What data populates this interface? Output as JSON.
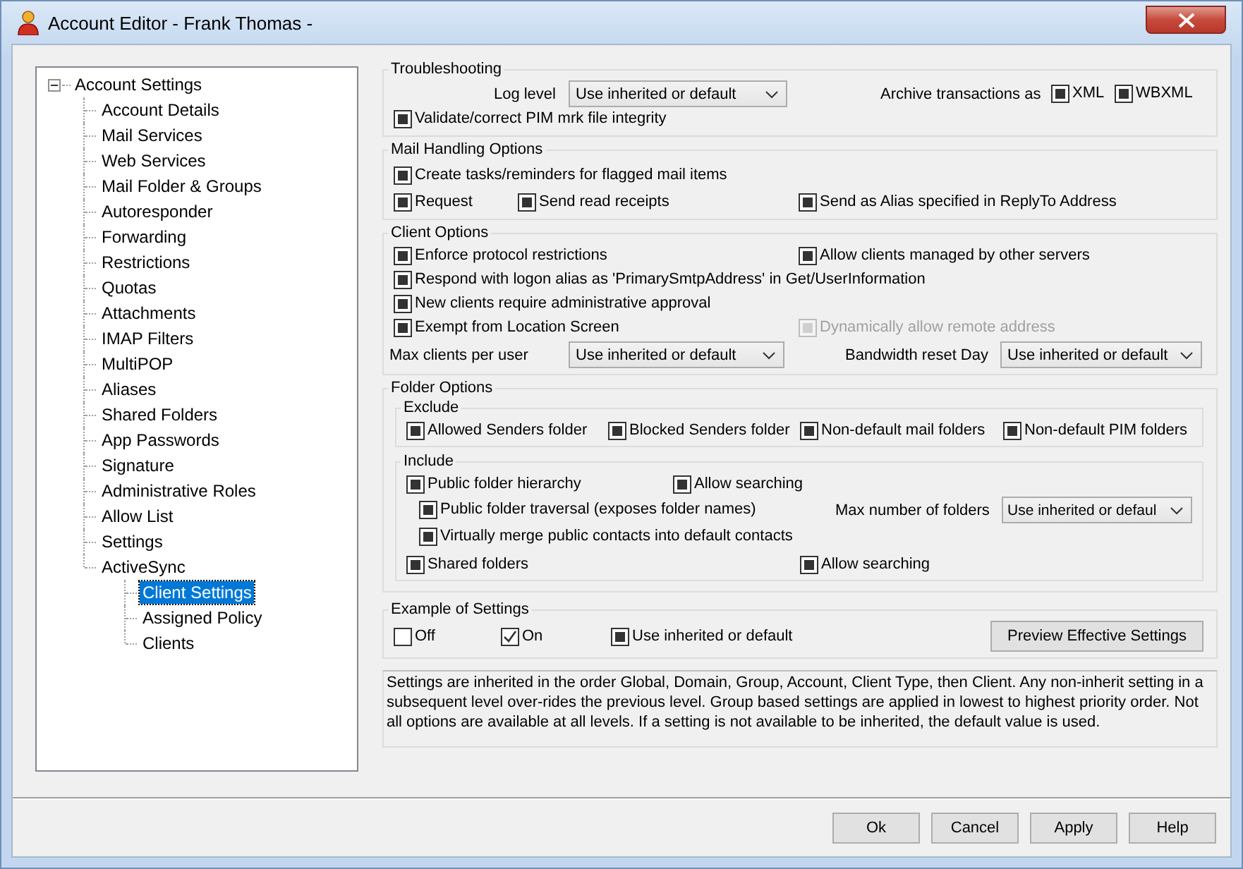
{
  "window": {
    "title": "Account Editor - Frank Thomas -"
  },
  "tree": {
    "label": "Account Settings",
    "expanded": true,
    "selected": false,
    "children": [
      {
        "label": "Account Details",
        "selected": false
      },
      {
        "label": "Mail Services",
        "selected": false
      },
      {
        "label": "Web Services",
        "selected": false
      },
      {
        "label": "Mail Folder & Groups",
        "selected": false
      },
      {
        "label": "Autoresponder",
        "selected": false
      },
      {
        "label": "Forwarding",
        "selected": false
      },
      {
        "label": "Restrictions",
        "selected": false
      },
      {
        "label": "Quotas",
        "selected": false
      },
      {
        "label": "Attachments",
        "selected": false
      },
      {
        "label": "IMAP Filters",
        "selected": false
      },
      {
        "label": "MultiPOP",
        "selected": false
      },
      {
        "label": "Aliases",
        "selected": false
      },
      {
        "label": "Shared Folders",
        "selected": false
      },
      {
        "label": "App Passwords",
        "selected": false
      },
      {
        "label": "Signature",
        "selected": false
      },
      {
        "label": "Administrative Roles",
        "selected": false
      },
      {
        "label": "Allow List",
        "selected": false
      },
      {
        "label": "Settings",
        "selected": false
      },
      {
        "label": "ActiveSync",
        "selected": false,
        "children": [
          {
            "label": "Client Settings",
            "selected": true
          },
          {
            "label": "Assigned Policy",
            "selected": false
          },
          {
            "label": "Clients",
            "selected": false
          }
        ]
      }
    ]
  },
  "sections": [
    {
      "title": "Troubleshooting",
      "rows": [
        {
          "items": [
            {
              "kind": "dropdown",
              "label": "Log level",
              "value": "Use inherited or default"
            },
            {
              "kind": "text",
              "text": "Archive transactions as"
            },
            {
              "kind": "checkbox",
              "label": "XML",
              "checked": false,
              "indeterminate": true,
              "disabled": false
            },
            {
              "kind": "checkbox",
              "label": "WBXML",
              "checked": false,
              "indeterminate": true,
              "disabled": false
            }
          ]
        },
        {
          "items": [
            {
              "kind": "checkbox",
              "label": "Validate/correct PIM mrk file integrity",
              "checked": false,
              "indeterminate": true,
              "disabled": false
            }
          ]
        }
      ]
    },
    {
      "title": "Mail Handling Options",
      "rows": [
        {
          "items": [
            {
              "kind": "checkbox",
              "label": "Create tasks/reminders for flagged mail items",
              "checked": false,
              "indeterminate": true,
              "disabled": false
            }
          ]
        },
        {
          "items": [
            {
              "kind": "checkbox",
              "label": "Request",
              "checked": false,
              "indeterminate": true,
              "disabled": false
            },
            {
              "kind": "checkbox",
              "label": "Send read receipts",
              "checked": false,
              "indeterminate": true,
              "disabled": false
            },
            {
              "kind": "checkbox",
              "label": "Send as Alias specified in ReplyTo Address",
              "checked": false,
              "indeterminate": true,
              "disabled": false
            }
          ]
        }
      ]
    },
    {
      "title": "Client Options",
      "rows": [
        {
          "items": [
            {
              "kind": "checkbox",
              "label": "Enforce protocol restrictions",
              "checked": false,
              "indeterminate": true,
              "disabled": false
            },
            {
              "kind": "checkbox",
              "label": "Allow clients managed by other servers",
              "checked": false,
              "indeterminate": true,
              "disabled": false
            }
          ]
        },
        {
          "items": [
            {
              "kind": "checkbox",
              "label": "Respond with logon alias as 'PrimarySmtpAddress' in Get/UserInformation",
              "checked": false,
              "indeterminate": true,
              "disabled": false
            }
          ]
        },
        {
          "items": [
            {
              "kind": "checkbox",
              "label": "New clients require administrative approval",
              "checked": false,
              "indeterminate": true,
              "disabled": false
            }
          ]
        },
        {
          "items": [
            {
              "kind": "checkbox",
              "label": "Exempt from Location Screen",
              "checked": false,
              "indeterminate": true,
              "disabled": false
            },
            {
              "kind": "checkbox",
              "label": "Dynamically allow remote address",
              "checked": false,
              "indeterminate": true,
              "disabled": true
            }
          ]
        },
        {
          "items": [
            {
              "kind": "dropdown",
              "label": "Max clients per user",
              "value": "Use inherited or default"
            },
            {
              "kind": "dropdown",
              "label": "Bandwidth reset Day",
              "value": "Use inherited or default"
            }
          ]
        }
      ]
    },
    {
      "title": "Folder Options",
      "groups": [
        {
          "title": "Exclude",
          "rows": [
            {
              "items": [
                {
                  "kind": "checkbox",
                  "label": "Allowed Senders folder",
                  "checked": false,
                  "indeterminate": true,
                  "disabled": false
                },
                {
                  "kind": "checkbox",
                  "label": "Blocked Senders folder",
                  "checked": false,
                  "indeterminate": true,
                  "disabled": false
                },
                {
                  "kind": "checkbox",
                  "label": "Non-default mail folders",
                  "checked": false,
                  "indeterminate": true,
                  "disabled": false
                },
                {
                  "kind": "checkbox",
                  "label": "Non-default PIM folders",
                  "checked": false,
                  "indeterminate": true,
                  "disabled": false
                }
              ]
            }
          ]
        },
        {
          "title": "Include",
          "rows": [
            {
              "items": [
                {
                  "kind": "checkbox",
                  "label": "Public folder hierarchy",
                  "checked": false,
                  "indeterminate": true,
                  "disabled": false
                },
                {
                  "kind": "checkbox",
                  "label": "Allow searching",
                  "checked": false,
                  "indeterminate": true,
                  "disabled": false
                }
              ]
            },
            {
              "items": [
                {
                  "kind": "checkbox",
                  "label": "Public folder traversal (exposes folder names)",
                  "checked": false,
                  "indeterminate": true,
                  "disabled": false
                },
                {
                  "kind": "dropdown",
                  "label": "Max number of folders",
                  "value": "Use inherited or defaul"
                }
              ]
            },
            {
              "items": [
                {
                  "kind": "checkbox",
                  "label": "Virtually merge public contacts into default contacts",
                  "checked": false,
                  "indeterminate": true,
                  "disabled": false
                }
              ]
            },
            {
              "items": [
                {
                  "kind": "checkbox",
                  "label": "Shared folders",
                  "checked": false,
                  "indeterminate": true,
                  "disabled": false
                },
                {
                  "kind": "checkbox",
                  "label": "Allow searching",
                  "checked": false,
                  "indeterminate": true,
                  "disabled": false
                }
              ]
            }
          ]
        }
      ]
    },
    {
      "title": "Example of Settings",
      "rows": [
        {
          "items": [
            {
              "kind": "checkbox",
              "label": "Off",
              "checked": false,
              "indeterminate": false,
              "disabled": false
            },
            {
              "kind": "checkbox",
              "label": "On",
              "checked": true,
              "indeterminate": false,
              "disabled": false
            },
            {
              "kind": "checkbox",
              "label": "Use inherited or default",
              "checked": false,
              "indeterminate": true,
              "disabled": false
            },
            {
              "kind": "button",
              "label": "Preview Effective Settings"
            }
          ]
        }
      ]
    }
  ],
  "description": "Settings are inherited in the order Global, Domain, Group, Account, Client Type, then Client. Any non-inherit setting in a subsequent level over-rides the previous level. Group based settings are applied in lowest to highest priority order. Not all options are available at all levels. If a setting is not available to be inherited, the default value is used.",
  "buttons": [
    "Ok",
    "Cancel",
    "Apply",
    "Help"
  ]
}
